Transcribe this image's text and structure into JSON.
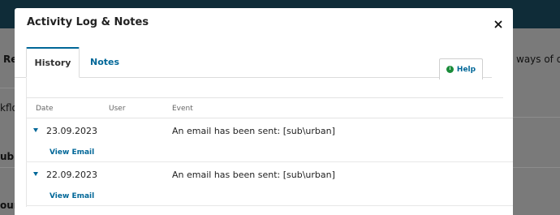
{
  "background": {
    "fragments": [
      "Rei",
      "kflo",
      "ubm",
      "oun"
    ],
    "right_text": "ways of de"
  },
  "modal": {
    "title": "Activity Log & Notes",
    "close_label": "×"
  },
  "tabs": [
    {
      "label": "History",
      "active": true
    },
    {
      "label": "Notes",
      "active": false
    }
  ],
  "help": {
    "label": "Help",
    "icon": "info-icon"
  },
  "table": {
    "columns": [
      "Date",
      "User",
      "Event"
    ],
    "rows": [
      {
        "date": "23.09.2023",
        "user": "",
        "event": "An email has been sent: [sub\\urban]",
        "link": "View Email"
      },
      {
        "date": "22.09.2023",
        "user": "",
        "event": "An email has been sent: [sub\\urban]",
        "link": "View Email"
      }
    ]
  },
  "colors": {
    "accent": "#006798",
    "help_icon": "#1a8c3a",
    "top_bar": "#0f2c38",
    "overlay": "#7a7a7a"
  }
}
